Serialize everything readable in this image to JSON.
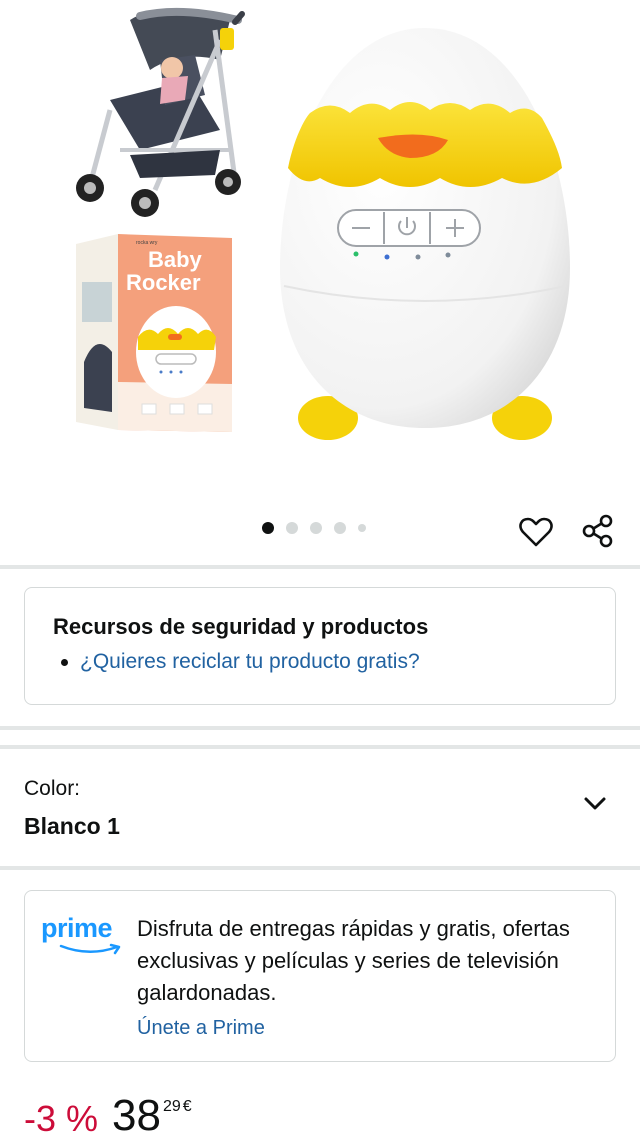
{
  "gallery": {
    "box_brand_small": "rocka wry",
    "box_title_line1": "Baby",
    "box_title_line2": "Rocker",
    "image_count": 5,
    "active_index": 0
  },
  "safety": {
    "title": "Recursos de seguridad y productos",
    "link": "¿Quieres reciclar tu producto gratis?"
  },
  "color": {
    "label": "Color:",
    "value": "Blanco 1",
    "icon": "chevron-down-icon"
  },
  "prime": {
    "logo": "prime",
    "description": "Disfruta de entregas rápidas y gratis, ofertas exclusivas y películas y series de televisión galardonadas.",
    "cta": "Únete a Prime"
  },
  "price": {
    "discount": "-3 %",
    "whole": "38",
    "fraction": "29",
    "currency": "€"
  },
  "colors": {
    "link": "#2162a1",
    "discount": "#cc0c39",
    "prime_blue": "#1a98ff",
    "egg_yellow": "#f5d20a",
    "beak_orange": "#f26c1d"
  }
}
